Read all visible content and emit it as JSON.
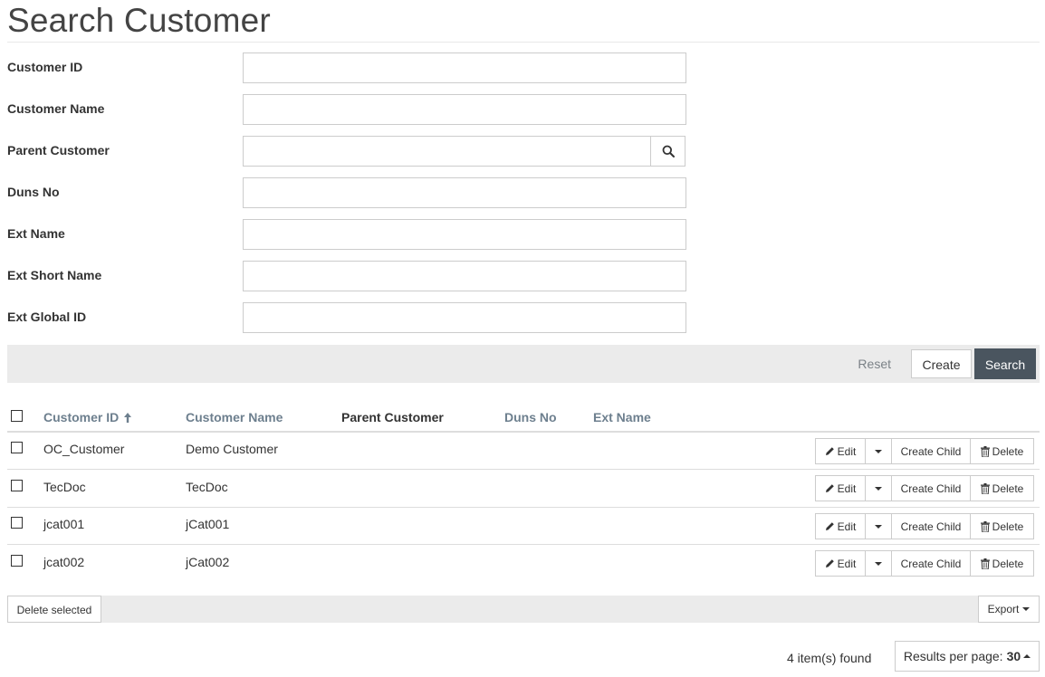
{
  "page": {
    "title": "Search Customer"
  },
  "form": {
    "fields": [
      {
        "label": "Customer ID",
        "value": "",
        "placeholder": ""
      },
      {
        "label": "Customer Name",
        "value": "",
        "placeholder": ""
      },
      {
        "label": "Parent Customer",
        "value": "",
        "placeholder": ""
      },
      {
        "label": "Duns No",
        "value": "",
        "placeholder": ""
      },
      {
        "label": "Ext Name",
        "value": "",
        "placeholder": ""
      },
      {
        "label": "Ext Short Name",
        "value": "",
        "placeholder": ""
      },
      {
        "label": "Ext Global ID",
        "value": "",
        "placeholder": ""
      }
    ],
    "lookup_icon": "search-icon"
  },
  "actions": {
    "reset": "Reset",
    "create": "Create",
    "search": "Search"
  },
  "table": {
    "columns": [
      {
        "label": "Customer ID",
        "sortable": true,
        "sort": "asc"
      },
      {
        "label": "Customer Name",
        "sortable": true
      },
      {
        "label": "Parent Customer",
        "sortable": false
      },
      {
        "label": "Duns No",
        "sortable": true
      },
      {
        "label": "Ext Name",
        "sortable": true
      }
    ],
    "rows": [
      {
        "customer_id": "OC_Customer",
        "customer_name": "Demo Customer"
      },
      {
        "customer_id": "TecDoc",
        "customer_name": "TecDoc"
      },
      {
        "customer_id": "jcat001",
        "customer_name": "jCat001"
      },
      {
        "customer_id": "jcat002",
        "customer_name": "jCat002"
      }
    ],
    "row_actions": {
      "edit": "Edit",
      "create_child": "Create Child",
      "delete": "Delete"
    }
  },
  "footer": {
    "delete_selected": "Delete selected",
    "export": "Export",
    "items_found": "4 item(s) found",
    "results_per_page_label": "Results per page:",
    "results_per_page_value": "30"
  },
  "colors": {
    "header_link": "#6d7f8e",
    "search_button_bg": "#4a555f",
    "bar_bg": "#ebebeb"
  }
}
